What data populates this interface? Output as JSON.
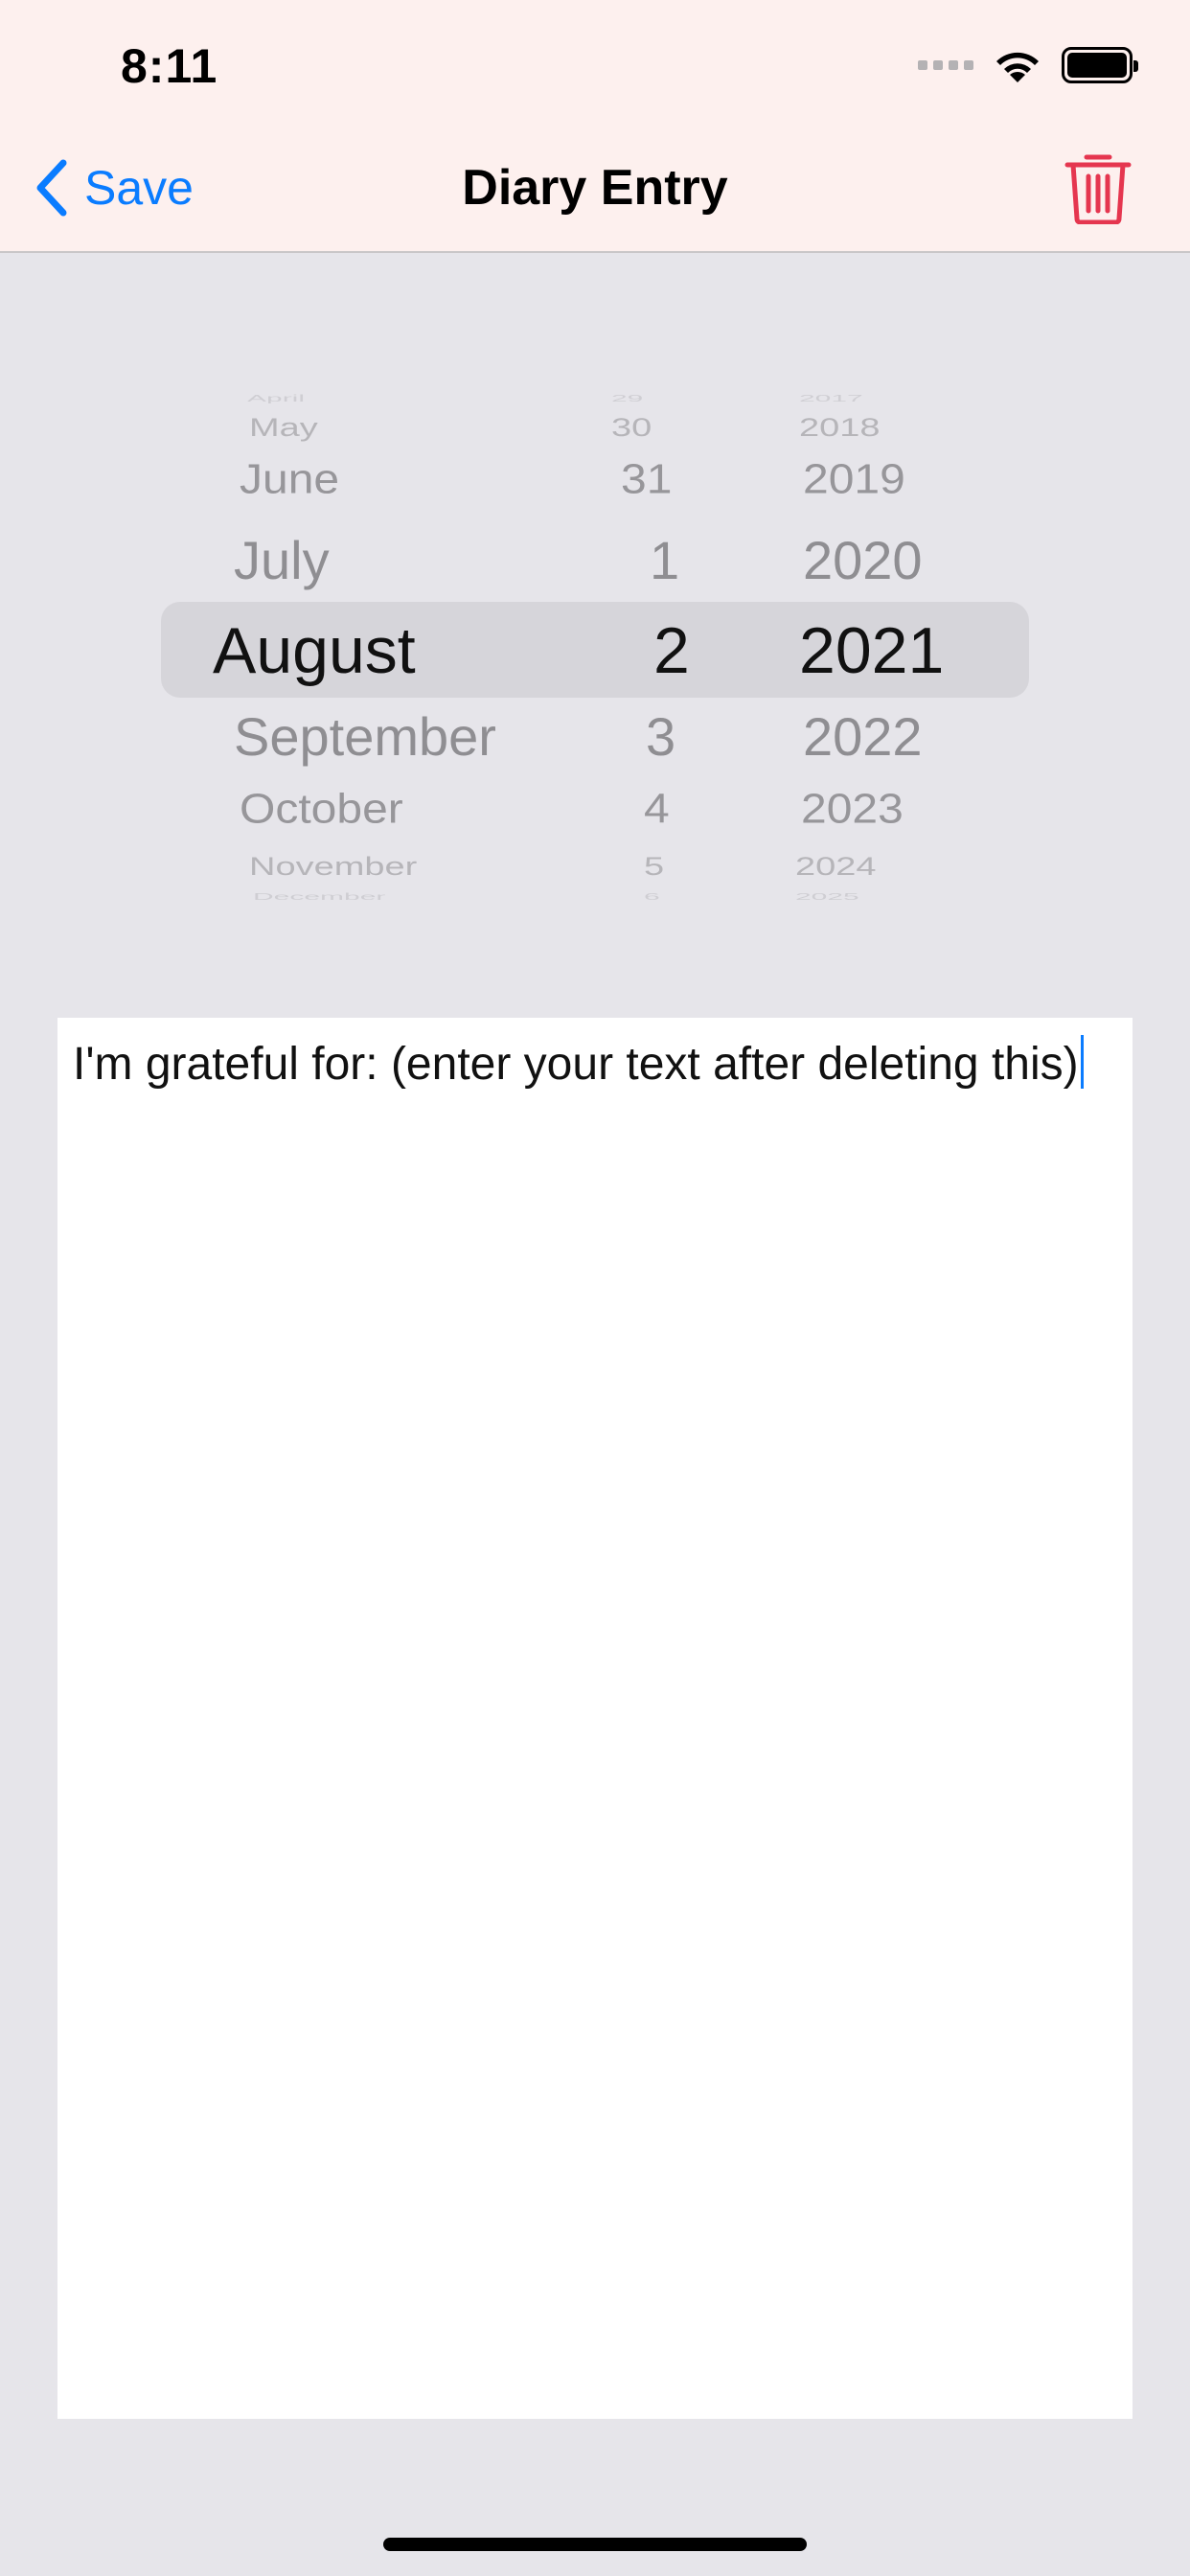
{
  "status_bar": {
    "time": "8:11"
  },
  "nav": {
    "back_label": "Save",
    "title": "Diary Entry"
  },
  "picker": {
    "months": [
      "April",
      "May",
      "June",
      "July",
      "August",
      "September",
      "October",
      "November",
      "December"
    ],
    "days": [
      "29",
      "30",
      "31",
      "1",
      "2",
      "3",
      "4",
      "5",
      "6"
    ],
    "years": [
      "2017",
      "2018",
      "2019",
      "2020",
      "2021",
      "2022",
      "2023",
      "2024",
      "2025"
    ],
    "selected": {
      "month": "August",
      "day": "2",
      "year": "2021"
    }
  },
  "editor": {
    "text": "I'm grateful for: (enter your text after deleting this)"
  },
  "colors": {
    "accent": "#0a7cff",
    "destructive": "#e5364f",
    "header_bg": "#fdf0ee",
    "page_bg": "#e6e5ea"
  }
}
